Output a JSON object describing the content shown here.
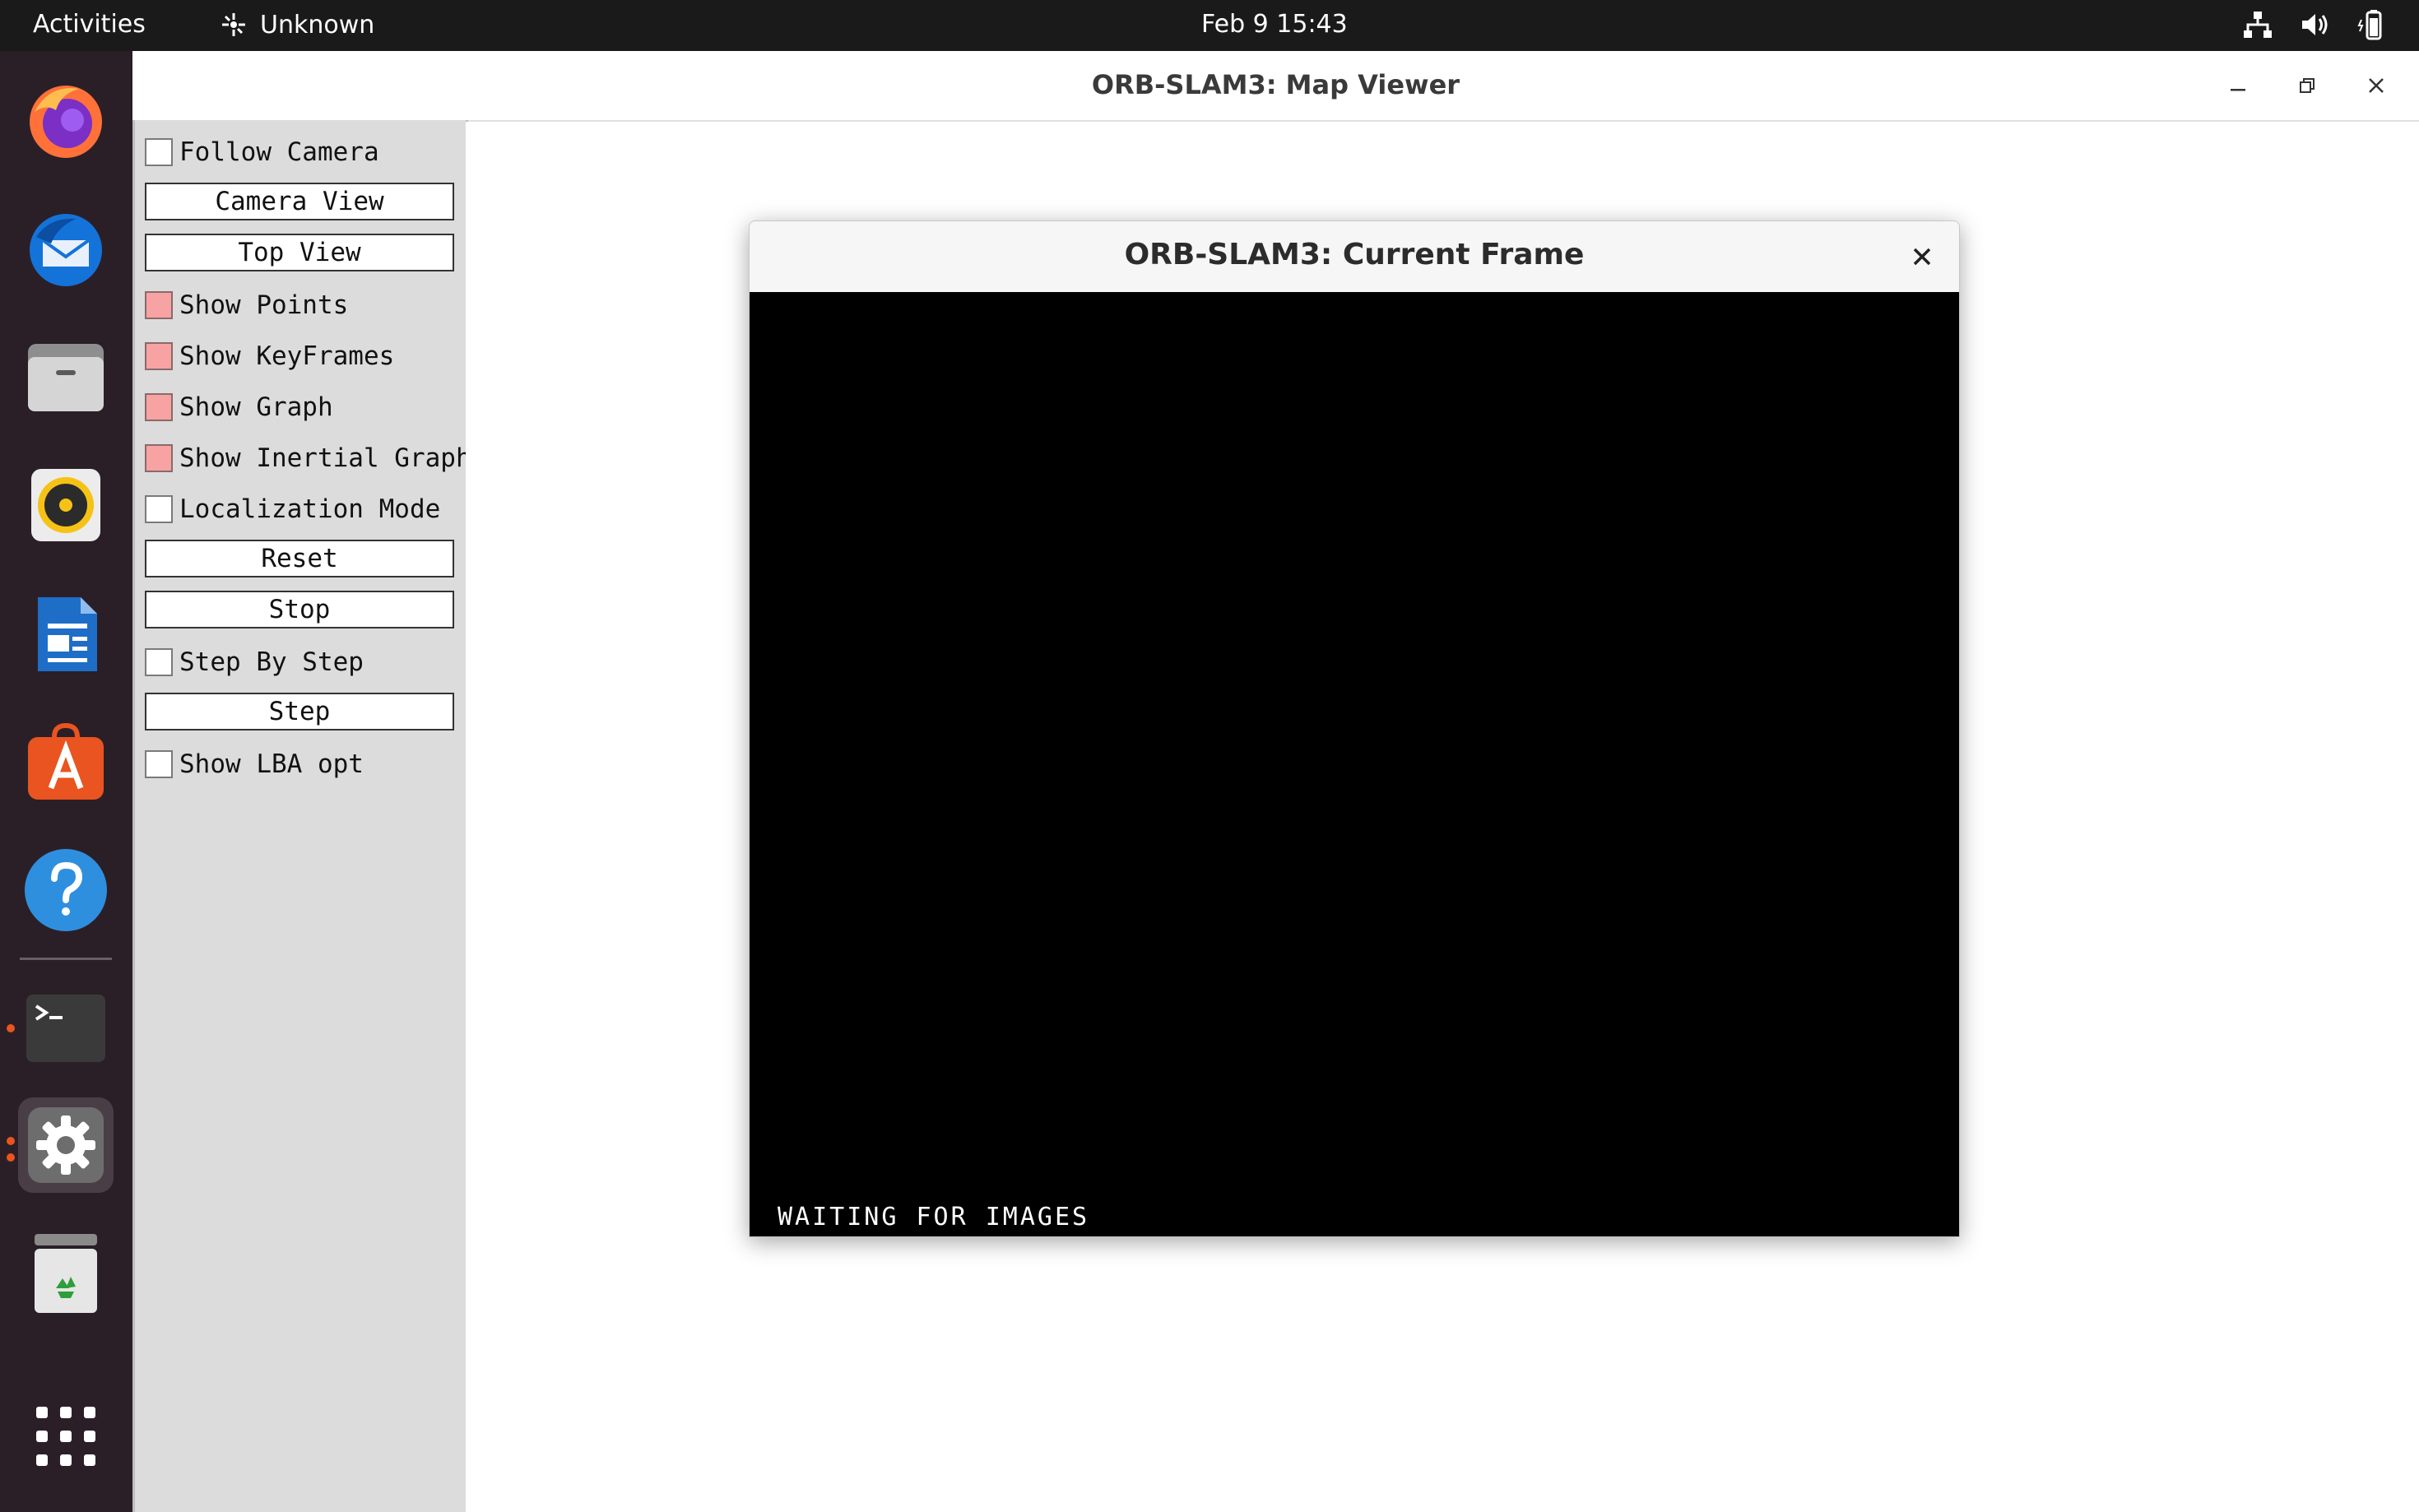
{
  "topbar": {
    "activities": "Activities",
    "app_name": "Unknown",
    "clock": "Feb 9  15:43"
  },
  "dock": {
    "apps": [
      "firefox-icon",
      "thunderbird-icon",
      "files-icon",
      "rhythmbox-icon",
      "libreoffice-writer-icon",
      "app-center-icon",
      "help-icon",
      "terminal-icon",
      "settings-icon",
      "trash-icon",
      "show-apps-icon"
    ]
  },
  "window": {
    "title": "ORB-SLAM3: Map Viewer"
  },
  "panel": {
    "follow_camera": "Follow Camera",
    "camera_view": "Camera View",
    "top_view": "Top View",
    "show_points": "Show Points",
    "show_keyframes": "Show KeyFrames",
    "show_graph": "Show Graph",
    "show_inertial_graph": "Show Inertial Graph",
    "localization_mode": "Localization Mode",
    "reset": "Reset",
    "stop": "Stop",
    "step_by_step": "Step By Step",
    "step": "Step",
    "show_lba_opt": "Show LBA opt"
  },
  "frame": {
    "title": "ORB-SLAM3: Current Frame",
    "status": "WAITING FOR IMAGES"
  },
  "colors": {
    "checkbox_on": "#f7a3a3",
    "accent": "#e95420"
  }
}
